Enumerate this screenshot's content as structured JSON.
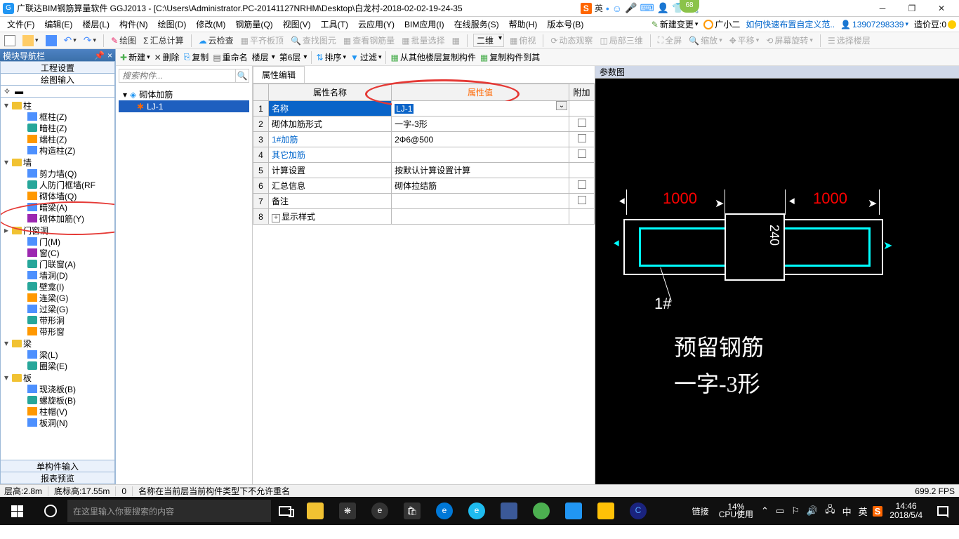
{
  "title": "广联达BIM钢筋算量软件 GGJ2013 - [C:\\Users\\Administrator.PC-20141127NRHM\\Desktop\\白龙村-2018-02-02-19-24-35",
  "ime": {
    "box": "S",
    "lang": "英"
  },
  "badge": "68",
  "menu": [
    "文件(F)",
    "编辑(E)",
    "楼层(L)",
    "构件(N)",
    "绘图(D)",
    "修改(M)",
    "钢筋量(Q)",
    "视图(V)",
    "工具(T)",
    "云应用(Y)",
    "BIM应用(I)",
    "在线服务(S)",
    "帮助(H)",
    "版本号(B)"
  ],
  "menu_right": {
    "newchange": "新建变更",
    "user": "广小二",
    "help": "如何快速布置自定义范..",
    "account": "13907298339",
    "beans": "造价豆:0"
  },
  "toolbar1": {
    "draw": "绘图",
    "sumcalc": "汇总计算",
    "cloud": "云检查",
    "flat": "平齐板顶",
    "findg": "查找图元",
    "viewrebar": "查看钢筋量",
    "batchsel": "批量选择",
    "dim2d": "二维",
    "over": "俯视",
    "dyn": "动态观察",
    "loc3d": "局部三维",
    "full": "全屏",
    "zoom": "缩放",
    "pan": "平移",
    "rot": "屏幕旋转",
    "selfloor": "选择楼层"
  },
  "nav": {
    "header": "模块导航栏",
    "tabs": [
      "工程设置",
      "绘图输入"
    ],
    "groups": [
      {
        "name": "柱",
        "items": [
          "框柱(Z)",
          "暗柱(Z)",
          "端柱(Z)",
          "构造柱(Z)"
        ]
      },
      {
        "name": "墙",
        "items": [
          "剪力墙(Q)",
          "人防门框墙(RF",
          "砌体墙(Q)",
          "暗梁(A)",
          "砌体加筋(Y)"
        ]
      },
      {
        "name": "门窗洞",
        "items": [
          "门(M)",
          "窗(C)",
          "门联窗(A)",
          "墙洞(D)",
          "壁龛(I)",
          "连梁(G)",
          "过梁(G)",
          "带形洞",
          "带形窗"
        ]
      },
      {
        "name": "梁",
        "items": [
          "梁(L)",
          "圈梁(E)"
        ]
      },
      {
        "name": "板",
        "items": [
          "现浇板(B)",
          "螺旋板(B)",
          "柱帽(V)",
          "板洞(N)"
        ]
      }
    ],
    "bottom": [
      "单构件输入",
      "报表预览"
    ]
  },
  "mid": {
    "toolbar": {
      "new": "新建",
      "del": "删除",
      "copy": "复制",
      "rename": "重命名",
      "floor": "楼层",
      "floor6": "第6层",
      "sort": "排序",
      "filter": "过滤",
      "copyfrom": "从其他楼层复制构件",
      "copyto": "复制构件到其"
    },
    "placeholder": "搜索构件...",
    "root": "砌体加筋",
    "child": "LJ-1"
  },
  "prop": {
    "tab": "属性编辑",
    "headers": {
      "name": "属性名称",
      "value": "属性值",
      "extra": "附加"
    },
    "rows": [
      {
        "n": "1",
        "name": "名称",
        "val": "LJ-1",
        "sel": true
      },
      {
        "n": "2",
        "name": "砌体加筋形式",
        "val": "一字-3形",
        "chk": true
      },
      {
        "n": "3",
        "name": "1#加筋",
        "val": "2Φ6@500",
        "chk": true,
        "link": true
      },
      {
        "n": "4",
        "name": "其它加筋",
        "val": "",
        "chk": true,
        "link": true
      },
      {
        "n": "5",
        "name": "计算设置",
        "val": "按默认计算设置计算"
      },
      {
        "n": "6",
        "name": "汇总信息",
        "val": "砌体拉结筋",
        "chk": true
      },
      {
        "n": "7",
        "name": "备注",
        "val": "",
        "chk": true
      },
      {
        "n": "8",
        "name": "显示样式",
        "val": "",
        "exp": true
      }
    ]
  },
  "diag": {
    "header": "参数图",
    "d1": "1000",
    "d2": "1000",
    "h": "240",
    "tag": "1#",
    "t1": "预留钢筋",
    "t2": "一字-3形"
  },
  "status": {
    "height": "层高:2.8m",
    "base": "底标高:17.55m",
    "unit": "0",
    "msg": "名称在当前层当前构件类型下不允许重名",
    "fps": "699.2 FPS"
  },
  "taskbar": {
    "search": "在这里输入你要搜索的内容",
    "link": "链接",
    "cpu1": "14%",
    "cpu2": "CPU使用",
    "lang": "中",
    "ime": "英",
    "time": "14:46",
    "date": "2018/5/4"
  }
}
